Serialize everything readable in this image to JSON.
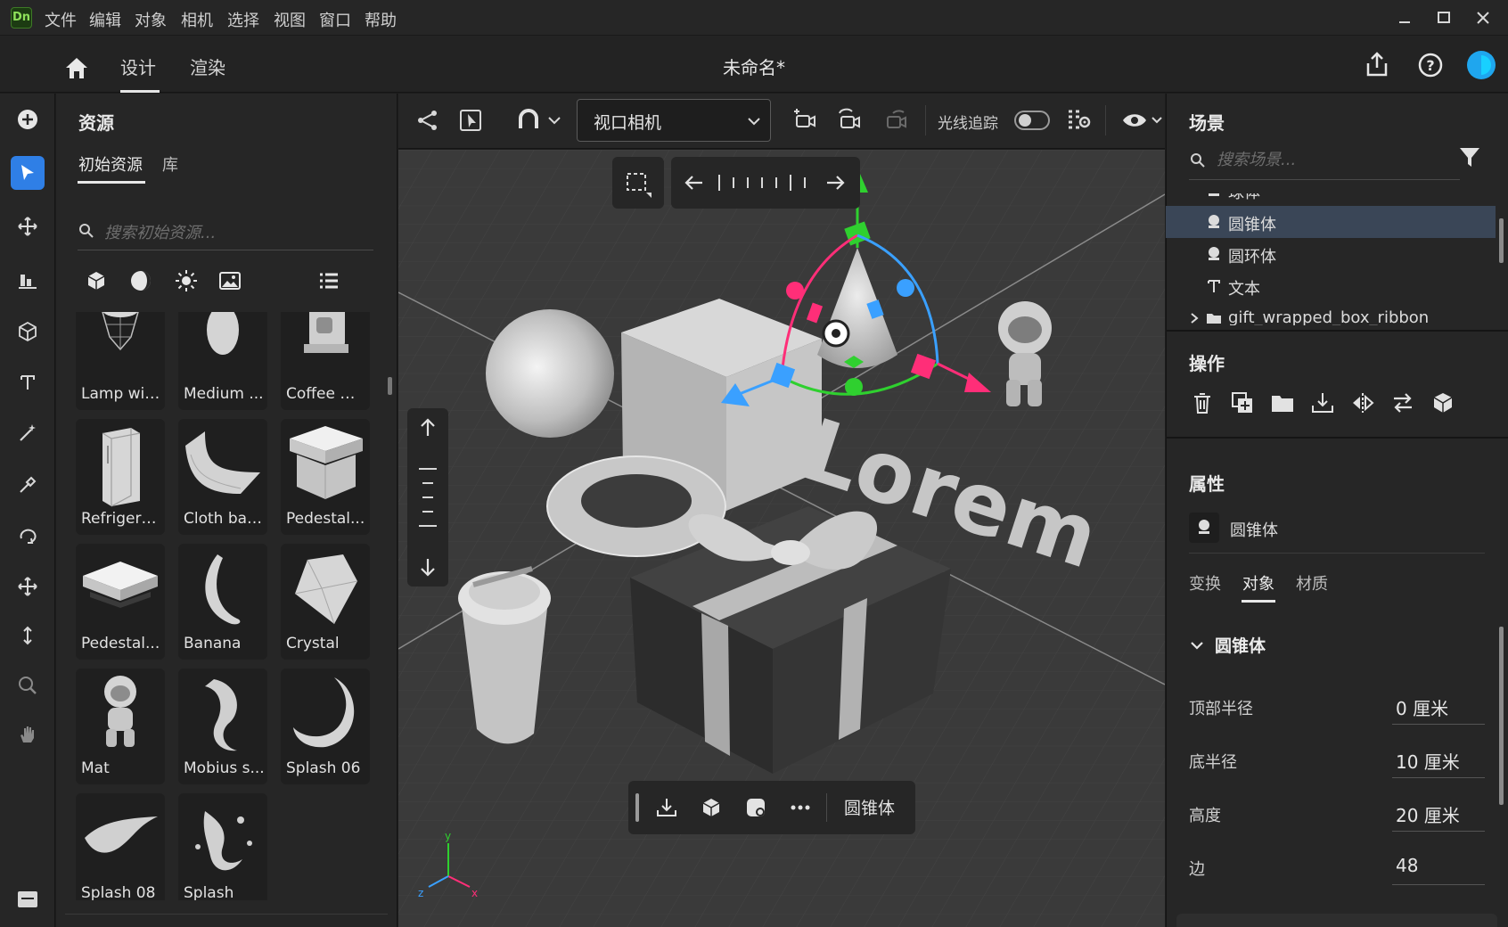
{
  "app": {
    "logo": "Dn"
  },
  "menu": [
    "文件",
    "编辑",
    "对象",
    "相机",
    "选择",
    "视图",
    "窗口",
    "帮助"
  ],
  "header": {
    "tabs": [
      "设计",
      "渲染"
    ],
    "doc_title": "未命名*"
  },
  "assets": {
    "title": "资源",
    "tabs": [
      "初始资源",
      "库"
    ],
    "search_placeholder": "搜索初始资源...",
    "filter_icons": [
      "cube-filter-icon",
      "material-filter-icon",
      "light-filter-icon",
      "image-filter-icon",
      "list-view-icon"
    ],
    "items": [
      "Lamp wir...",
      "Medium ...",
      "Coffee m...",
      "Refrigera...",
      "Cloth bac...",
      "Pedestal...",
      "Pedestal...",
      "Banana",
      "Crystal",
      "Mat",
      "Mobius s...",
      "Splash 06",
      "Splash 08",
      "Splash"
    ]
  },
  "viewport": {
    "camera": "视口相机",
    "raytrace_label": "光线追踪",
    "raytrace_on": false,
    "context_label": "圆锥体",
    "scene_text": "Lorem",
    "axis_labels": [
      "y",
      "z",
      "x"
    ]
  },
  "scene": {
    "title": "场景",
    "search_placeholder": "搜索场景...",
    "tree": [
      {
        "label": "球体",
        "icon": "shape-icon"
      },
      {
        "label": "圆锥体",
        "icon": "shape-icon",
        "selected": true
      },
      {
        "label": "圆环体",
        "icon": "shape-icon"
      },
      {
        "label": "文本",
        "icon": "text-3d-icon"
      },
      {
        "label": "gift_wrapped_box_ribbon",
        "icon": "folder-icon"
      }
    ],
    "operations_title": "操作",
    "operations": [
      "delete-icon",
      "duplicate-icon",
      "group-icon",
      "drop-to-ground-icon",
      "mirror-icon",
      "swap-icon",
      "convert-icon"
    ]
  },
  "properties": {
    "title": "属性",
    "object_name": "圆锥体",
    "tabs": [
      "变换",
      "对象",
      "材质"
    ],
    "section": "圆锥体",
    "fields": [
      {
        "label": "顶部半径",
        "value": "0 厘米"
      },
      {
        "label": "底半径",
        "value": "10 厘米"
      },
      {
        "label": "高度",
        "value": "20 厘米"
      },
      {
        "label": "边",
        "value": "48"
      }
    ]
  },
  "colors": {
    "accent": "#2f7fe6",
    "selected_row": "#3a4657",
    "gizmo_green": "#2fd02f",
    "gizmo_blue": "#3aa0ff",
    "gizmo_pink": "#ff2e78"
  }
}
